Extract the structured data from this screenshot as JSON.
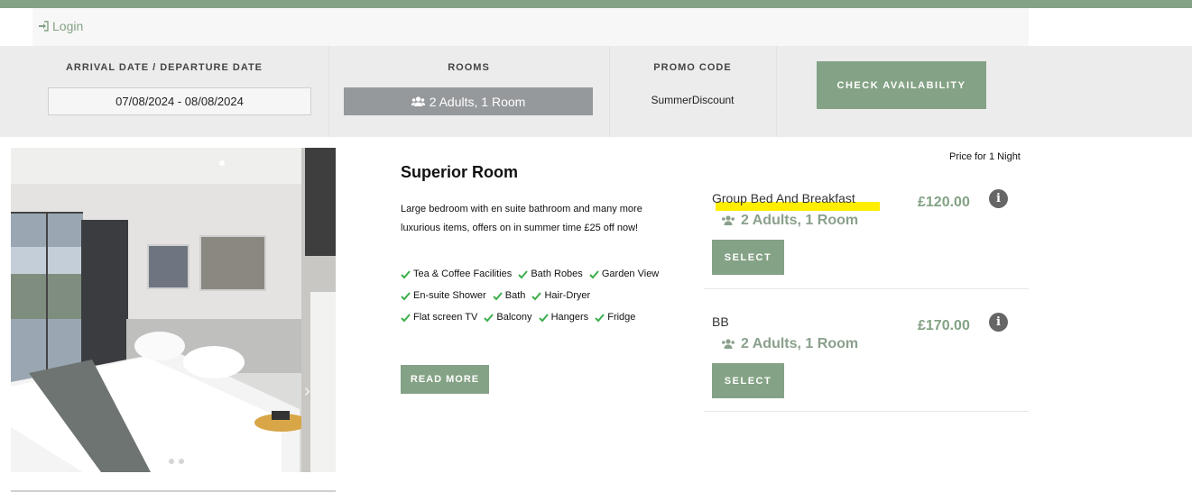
{
  "header": {
    "login_label": "Login",
    "accent_color": "#84a285"
  },
  "search": {
    "dates_label": "ARRIVAL DATE / DEPARTURE DATE",
    "dates_value": "07/08/2024 - 08/08/2024",
    "rooms_label": "ROOMS",
    "rooms_value": "2 Adults, 1 Room",
    "promo_label": "PROMO CODE",
    "promo_value": "SummerDiscount",
    "check_label": "CHECK AVAILABILITY"
  },
  "gallery": {
    "slide_count": 3,
    "active_slide": 1,
    "prev_icon": "chevron-left-icon",
    "next_icon": "chevron-right-icon"
  },
  "room": {
    "title": "Superior Room",
    "description": "Large bedroom with en suite bathroom and many more luxurious items, offers on in summer time £25 off now!",
    "amenities": [
      "Tea & Coffee Facilities",
      "Bath Robes",
      "Garden View",
      "En-suite Shower",
      "Bath",
      "Hair-Dryer",
      "Flat screen TV",
      "Balcony",
      "Hangers",
      "Fridge"
    ],
    "read_more_label": "READ MORE"
  },
  "rates": {
    "price_note": "Price for 1 Night",
    "items": [
      {
        "name": "Group Bed And Breakfast",
        "occupancy": "2 Adults, 1 Room",
        "price": "£120.00",
        "select_label": "SELECT"
      },
      {
        "name": "BB",
        "occupancy": "2 Adults, 1 Room",
        "price": "£170.00",
        "select_label": "SELECT"
      }
    ]
  }
}
